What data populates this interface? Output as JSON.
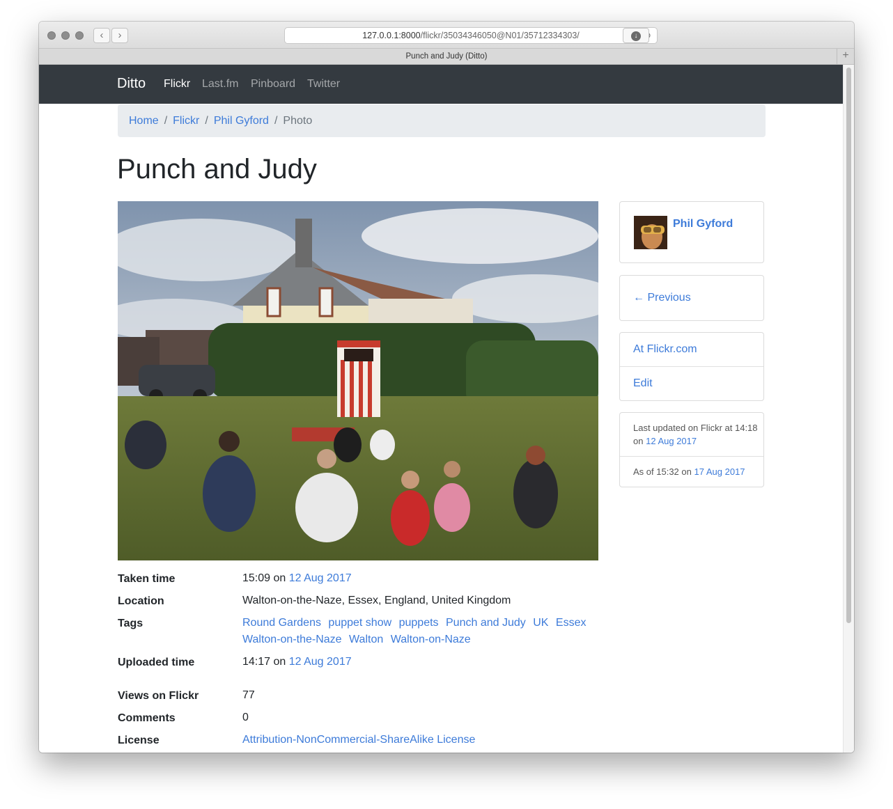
{
  "browser": {
    "url_host": "127.0.0.1:8000",
    "url_path": "/flickr/35034346050@N01/35712334303/",
    "tab_title": "Punch and Judy (Ditto)",
    "back_glyph": "‹",
    "forward_glyph": "›",
    "reload_glyph": "↻",
    "download_glyph": "↓",
    "newtab_glyph": "+"
  },
  "navbar": {
    "brand": "Ditto",
    "links": [
      "Flickr",
      "Last.fm",
      "Pinboard",
      "Twitter"
    ],
    "active": "Flickr"
  },
  "breadcrumb": {
    "items": [
      "Home",
      "Flickr",
      "Phil Gyford"
    ],
    "current": "Photo",
    "separator": "/"
  },
  "page": {
    "title": "Punch and Judy"
  },
  "details": {
    "taken": {
      "label": "Taken time",
      "time": "15:09",
      "on": "on",
      "date": "12 Aug 2017"
    },
    "location": {
      "label": "Location",
      "value": "Walton-on-the-Naze, Essex, England, United Kingdom"
    },
    "tags": {
      "label": "Tags",
      "items": [
        "Round Gardens",
        "puppet show",
        "puppets",
        "Punch and Judy",
        "UK",
        "Essex",
        "Walton-on-the-Naze",
        "Walton",
        "Walton-on-Naze"
      ]
    },
    "uploaded": {
      "label": "Uploaded time",
      "time": "14:17",
      "on": "on",
      "date": "12 Aug 2017"
    },
    "views": {
      "label": "Views on Flickr",
      "value": "77"
    },
    "comments": {
      "label": "Comments",
      "value": "0"
    },
    "license": {
      "label": "License",
      "value": "Attribution-NonCommercial-ShareAlike License"
    }
  },
  "sidebar": {
    "user": {
      "name": "Phil Gyford"
    },
    "previous": "← Previous",
    "links": [
      "At Flickr.com",
      "Edit"
    ],
    "updated": {
      "prefix": "Last updated on Flickr at",
      "time": "14:18",
      "on": "on",
      "date": "12 Aug 2017"
    },
    "asof": {
      "prefix": "As of",
      "time": "15:32",
      "on": "on",
      "date": "17 Aug 2017"
    }
  },
  "colors": {
    "link": "#3d7bd9",
    "navbar": "#343a40",
    "breadcrumb_bg": "#e9ecef"
  }
}
